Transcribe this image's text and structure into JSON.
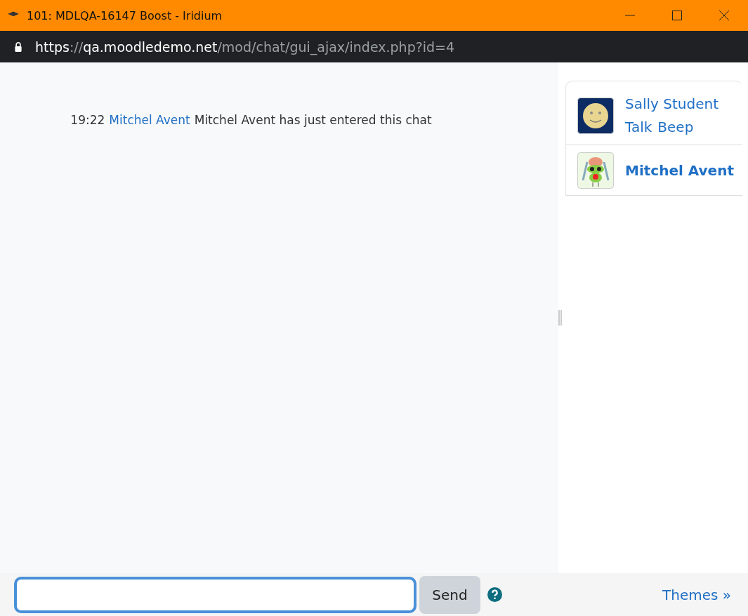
{
  "window": {
    "title": "101: MDLQA-16147 Boost - Iridium"
  },
  "address_bar": {
    "scheme": "https",
    "separator": "://",
    "host": "qa.moodledemo.net",
    "path": "/mod/chat/gui_ajax/index.php?id=4"
  },
  "messages": [
    {
      "time": "19:22",
      "user": "Mitchel Avent",
      "text": "Mitchel Avent has just entered this chat"
    }
  ],
  "users": [
    {
      "name": "Sally Student",
      "current": false,
      "kind": "smiley",
      "actions": [
        "Talk",
        "Beep"
      ]
    },
    {
      "name": "Mitchel Avent",
      "current": true,
      "kind": "creature"
    }
  ],
  "composer": {
    "send_button": "Send",
    "themes_link": "Themes »"
  }
}
